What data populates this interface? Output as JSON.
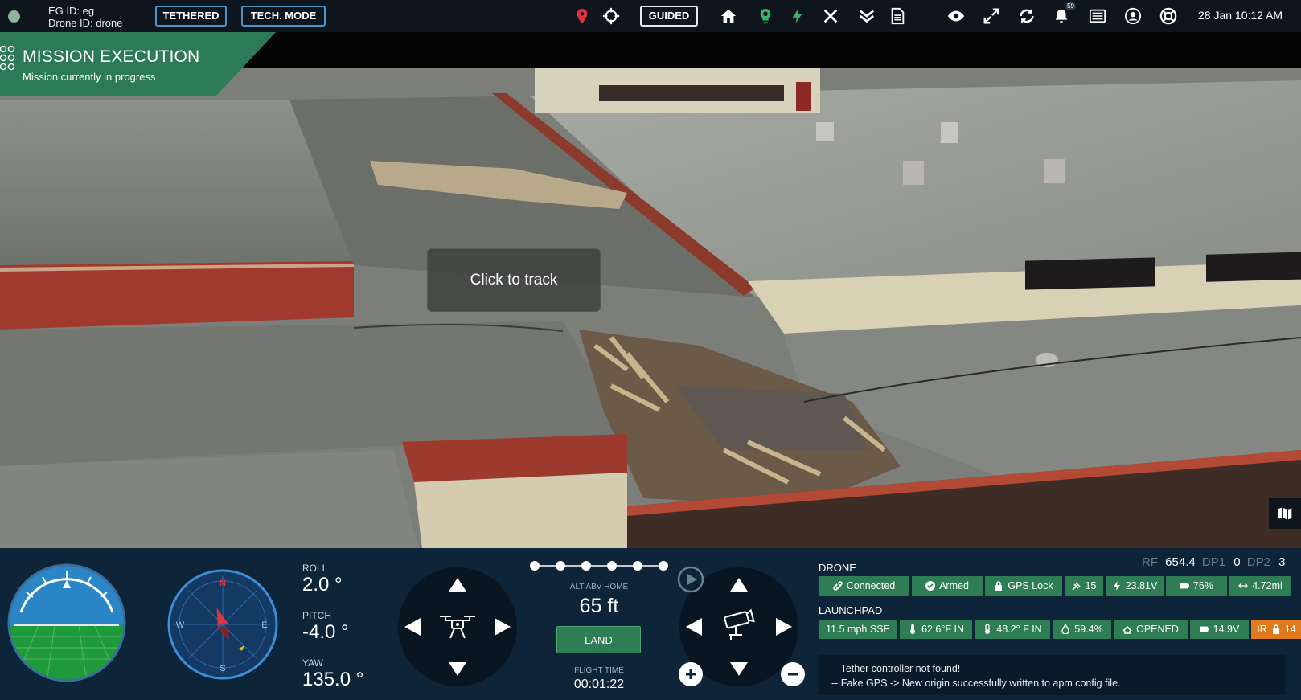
{
  "topbar": {
    "eg_id": "EG ID: eg",
    "drone_id": "Drone ID: drone",
    "tethered": "TETHERED",
    "tech_mode": "TECH. MODE",
    "mode": "GUIDED",
    "notification_count": "59",
    "datetime": "28 Jan 10:12 AM",
    "icons": [
      "location-pin-icon",
      "crosshair-icon",
      "home-icon",
      "bulb-icon",
      "bolt-icon",
      "close-icon",
      "double-chevron-down-icon",
      "document-icon",
      "eye-icon",
      "expand-icon",
      "refresh-icon",
      "bell-icon",
      "list-icon",
      "user-icon",
      "support-icon"
    ]
  },
  "mission": {
    "title": "MISSION EXECUTION",
    "subtitle": "Mission currently in progress"
  },
  "video": {
    "track_label": "Click to track"
  },
  "attitude": {
    "roll_label": "ROLL",
    "roll_value": "2.0 °",
    "pitch_label": "PITCH",
    "pitch_value": "-4.0 °",
    "yaw_label": "YAW",
    "yaw_value": "135.0 °"
  },
  "compass": {
    "n": "N",
    "e": "E",
    "s": "S",
    "w": "W"
  },
  "center": {
    "alt_label": "ALT ABV HOME",
    "alt_value": "65 ft",
    "land_label": "LAND",
    "flight_time_label": "FLIGHT TIME",
    "flight_time_value": "00:01:22",
    "step_count": 6
  },
  "drone": {
    "title": "DRONE",
    "rf_label": "RF",
    "rf_value": "654.4",
    "dp1_label": "DP1",
    "dp1_value": "0",
    "dp2_label": "DP2",
    "dp2_value": "3",
    "chips": [
      "Connected",
      "Armed",
      "GPS Lock",
      "15",
      "23.81V",
      "76%",
      "4.72mi"
    ]
  },
  "launchpad": {
    "title": "LAUNCHPAD",
    "chips": [
      "11.5 mph SSE",
      "62.6°F IN",
      "48.2° F IN",
      "59.4%",
      "OPENED",
      "14.9V",
      "IR",
      "14"
    ]
  },
  "log": {
    "lines": [
      "--  Tether controller not found!",
      "--  Fake GPS -> New origin successfully written to apm config file."
    ]
  },
  "colors": {
    "accent_green": "#2e7d55",
    "accent_orange": "#e07a1c",
    "panel_bg": "#0e2438",
    "pill_blue": "#4b93c9"
  }
}
